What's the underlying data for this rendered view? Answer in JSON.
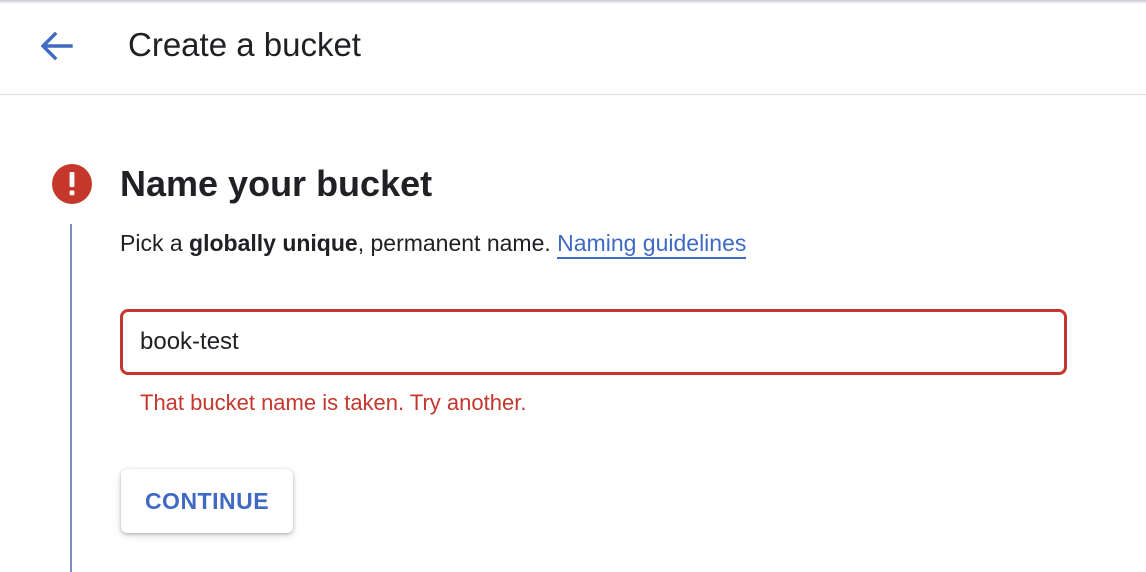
{
  "header": {
    "title": "Create a bucket",
    "back_icon": "arrow-left-icon"
  },
  "step": {
    "status_icon": "error-exclamation-icon",
    "title": "Name your bucket",
    "description_prefix": "Pick a ",
    "description_bold": "globally unique",
    "description_suffix": ", permanent name. ",
    "guidelines_link": "Naming guidelines"
  },
  "bucket_name_field": {
    "value": "book-test",
    "error": "That bucket name is taken. Try another."
  },
  "continue_button": {
    "label": "CONTINUE"
  },
  "colors": {
    "accent": "#3f6ac4",
    "error": "#c5372c",
    "step_line": "#7e8fc4",
    "text": "#202124"
  }
}
